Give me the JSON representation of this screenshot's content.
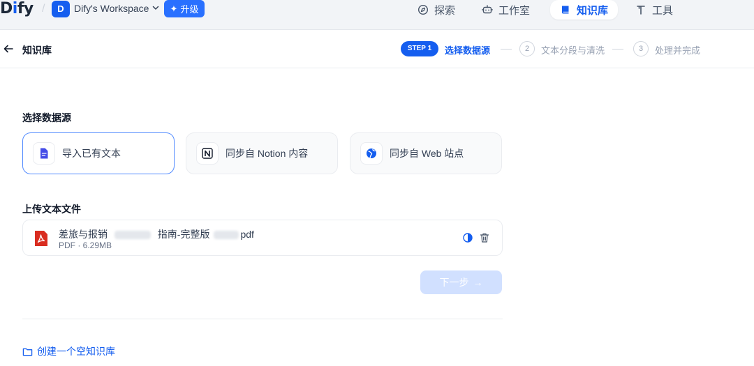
{
  "app": {
    "logo_prefix": "D",
    "logo_accent": "i",
    "logo_suffix": "fy",
    "separator": "/",
    "workspace_initial": "D",
    "workspace_name": "Dify's Workspace",
    "upgrade_label": "升级"
  },
  "nav": {
    "explore": "探索",
    "studio": "工作室",
    "knowledge": "知识库",
    "tools": "工具"
  },
  "subheader": {
    "title": "知识库",
    "step1_badge": "STEP 1",
    "step1_label": "选择数据源",
    "step2_num": "2",
    "step2_label": "文本分段与清洗",
    "step3_num": "3",
    "step3_label": "处理并完成"
  },
  "main": {
    "datasource_title": "选择数据源",
    "sources": [
      {
        "label": "导入已有文本",
        "icon": "file-text-icon",
        "selected": true
      },
      {
        "label": "同步自 Notion 内容",
        "icon": "notion-icon",
        "selected": false
      },
      {
        "label": "同步自 Web 站点",
        "icon": "web-globe-icon",
        "selected": false
      }
    ],
    "upload_title": "上传文本文件",
    "file": {
      "name_part1": "差旅与报销",
      "name_part2": "指南-完整版",
      "name_part3": "pdf",
      "meta": "PDF · 6.29MB"
    },
    "next_label": "下一步",
    "create_empty_label": "创建一个空知识库"
  },
  "colors": {
    "primary": "#155eef",
    "topbar_bg": "#f2f4f7",
    "next_disabled": "#d1e0ff",
    "pdf_red": "#d92d20"
  }
}
